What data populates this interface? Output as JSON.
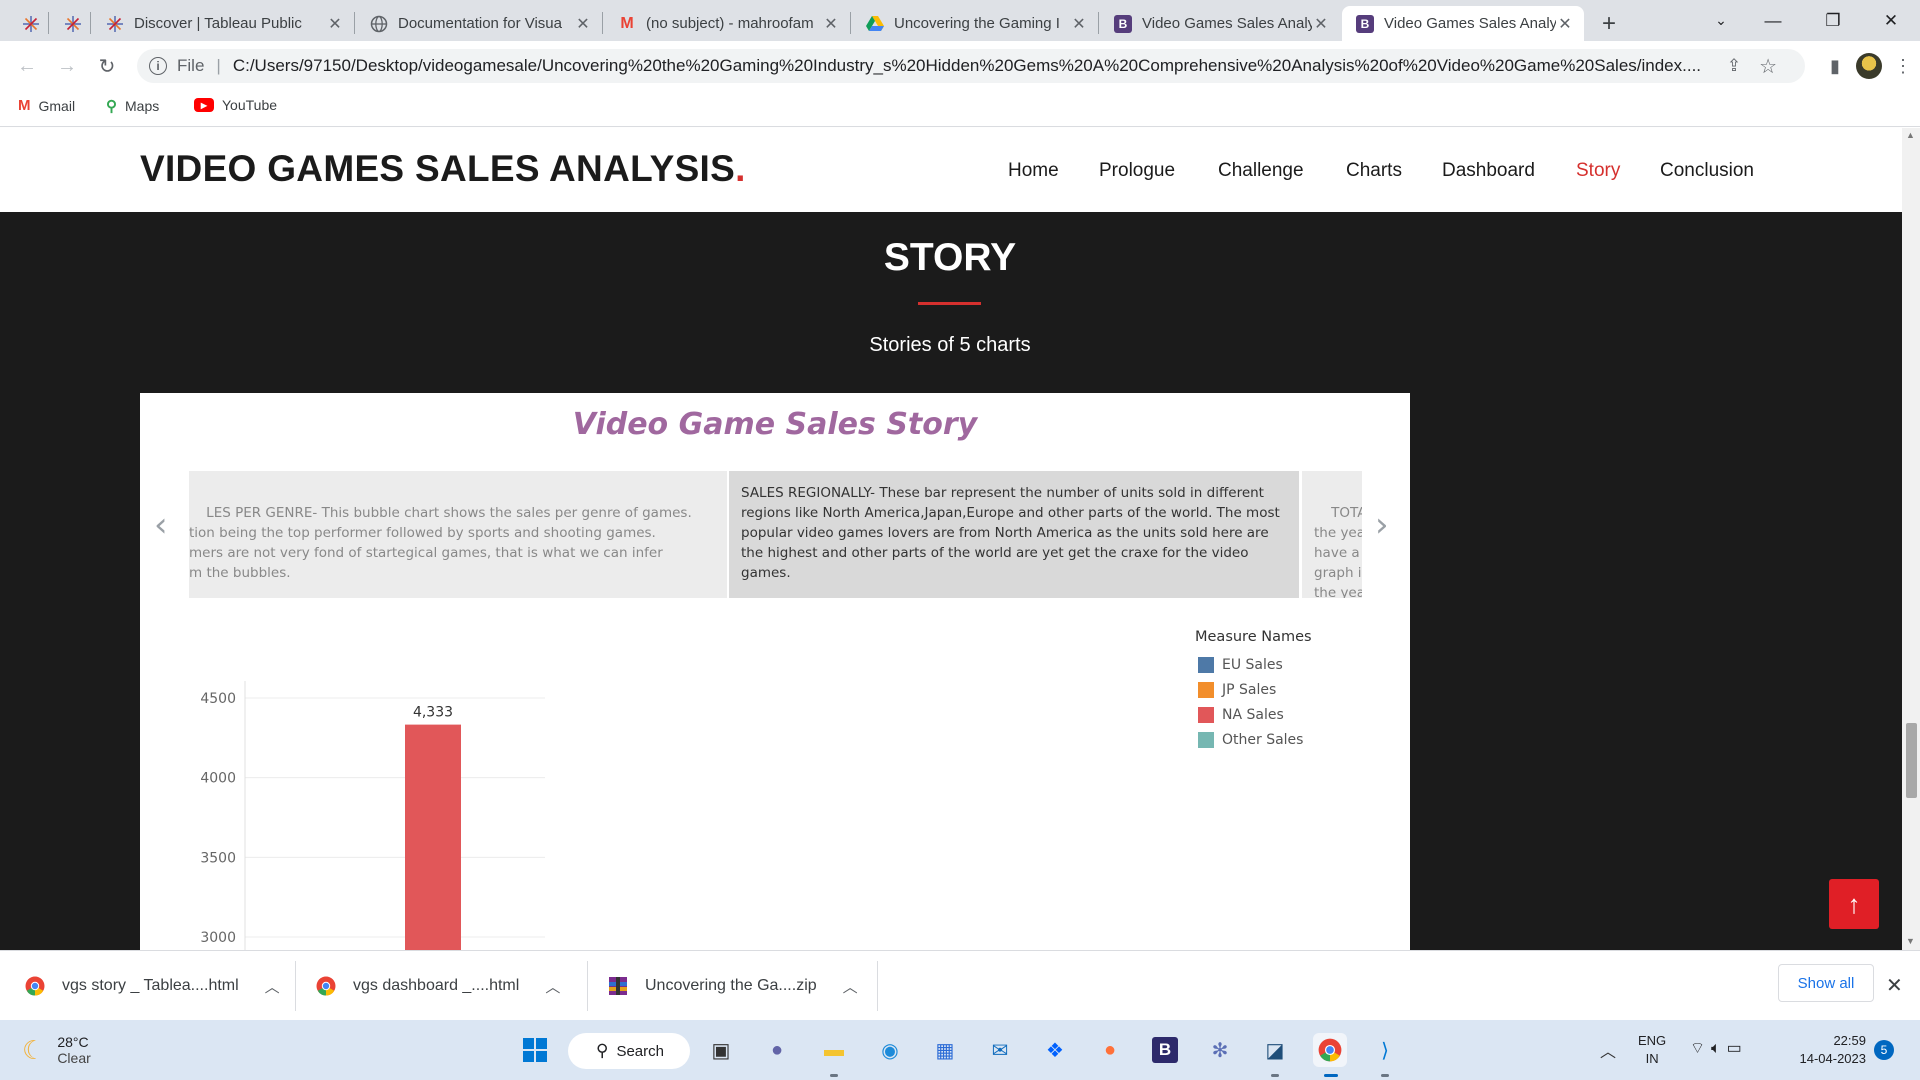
{
  "browser": {
    "tabs": [
      {
        "title": ""
      },
      {
        "title": ""
      },
      {
        "title": "Discover | Tableau Public"
      },
      {
        "title": "Documentation for Visua"
      },
      {
        "title": "(no subject) - mahroofam"
      },
      {
        "title": "Uncovering the Gaming I"
      },
      {
        "title": "Video Games Sales Analy"
      },
      {
        "title": "Video Games Sales Analy"
      }
    ],
    "new_tab": "+",
    "address_scheme": "File",
    "address_url": "C:/Users/97150/Desktop/videogamesale/Uncovering%20the%20Gaming%20Industry_s%20Hidden%20Gems%20A%20Comprehensive%20Analysis%20of%20Video%20Game%20Sales/index....",
    "bookmarks": [
      {
        "label": "Gmail"
      },
      {
        "label": "Maps"
      },
      {
        "label": "YouTube"
      }
    ],
    "colors": {
      "tabstrip": "#dee1e6",
      "omnibox": "#f1f3f4"
    }
  },
  "site": {
    "brand": "VIDEO GAMES SALES ANALYSIS",
    "brand_dot": ".",
    "nav": [
      "Home",
      "Prologue",
      "Challenge",
      "Charts",
      "Dashboard",
      "Story",
      "Conclusion"
    ],
    "active_nav": "Story",
    "accent": "#d5302e"
  },
  "story": {
    "heading": "STORY",
    "subheading": "Stories of 5 charts",
    "panel_title": "Video Game Sales Story",
    "cards": [
      {
        "text": "LES PER GENRE- This bubble chart shows the sales per genre of games.\ntion being the top performer followed by sports and shooting games.\nmers are not very fond of startegical games, that is what we can infer\nm the bubbles."
      },
      {
        "text": "SALES REGIONALLY- These bar represent the number of units sold in different regions like North America,Japan,Europe and other parts of the world. The most popular video games lovers are from North America as the units sold here are the highest and other parts of the world are yet get the craxe for the video games."
      },
      {
        "text": "TOTAL\nthe yea\nhave a\ngraph i\nthe yea"
      }
    ]
  },
  "chart_data": {
    "type": "bar",
    "categories": [
      "NA Sales"
    ],
    "series": [
      {
        "name": "NA Sales",
        "values": [
          4333
        ]
      }
    ],
    "data_labels": [
      "4,333"
    ],
    "y_ticks": [
      4500,
      4000,
      3500,
      3000
    ],
    "ylim": [
      3000,
      4600
    ],
    "grid": true,
    "legend": {
      "title": "Measure Names",
      "placement": "top-right",
      "items": [
        {
          "label": "EU Sales",
          "color": "#4e79a7"
        },
        {
          "label": "JP Sales",
          "color": "#f28e2b"
        },
        {
          "label": "NA Sales",
          "color": "#e15759"
        },
        {
          "label": "Other Sales",
          "color": "#76b7b2"
        }
      ]
    }
  },
  "downloads": {
    "items": [
      {
        "name": "vgs story _ Tablea....html"
      },
      {
        "name": "vgs dashboard _....html"
      },
      {
        "name": "Uncovering the Ga....zip"
      }
    ],
    "show_all": "Show all"
  },
  "taskbar": {
    "weather_temp": "28°C",
    "weather_desc": "Clear",
    "search_label": "Search",
    "lang": "ENG",
    "region": "IN",
    "time": "22:59",
    "date": "14-04-2023",
    "notifications": "5"
  }
}
